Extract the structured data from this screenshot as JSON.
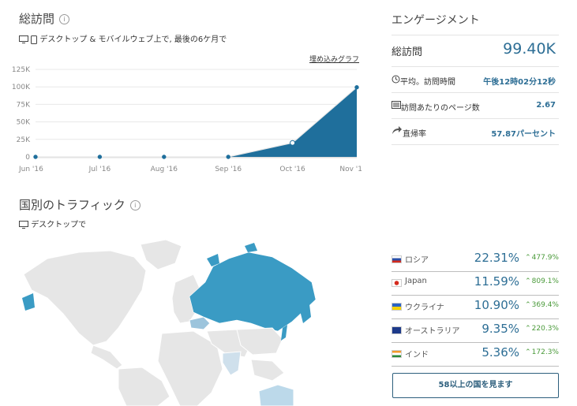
{
  "visits": {
    "title": "総訪問",
    "info_icon": "i",
    "subtitle": "デスクトップ & モバイルウェブ上で, 最後の6ケ月で",
    "embed_link": "埋め込みグラフ"
  },
  "chart_data": {
    "type": "area",
    "categories": [
      "Jun '16",
      "Jul '16",
      "Aug '16",
      "Sep '16",
      "Oct '16",
      "Nov '1"
    ],
    "series": [
      {
        "values": [
          0,
          0,
          0,
          0,
          20000,
          99400
        ]
      }
    ],
    "yticks": [
      "125K",
      "100K",
      "75K",
      "50K",
      "25K",
      "0"
    ],
    "ylim": [
      0,
      125000
    ],
    "grid": true,
    "color": "#1f6f9c"
  },
  "engagement": {
    "title": "エンゲージメント",
    "total_label": "総訪問",
    "total_value": "99.40K",
    "rows": [
      {
        "icon": "clock-icon",
        "label": "平均。訪問時間",
        "value": "午後12時02分12秒"
      },
      {
        "icon": "pages-icon",
        "label": "訪問あたりのページ数",
        "value": "2.67"
      },
      {
        "icon": "bounce-icon",
        "label": "直帰率",
        "value": "57.87パーセント"
      }
    ]
  },
  "traffic": {
    "title": "国別のトラフィック",
    "info_icon": "i",
    "subtitle": "デスクトップで",
    "countries": [
      {
        "name": "ロシア",
        "pct": "22.31%",
        "growth": "477.9%",
        "flag": "russia"
      },
      {
        "name": "Japan",
        "pct": "11.59%",
        "growth": "809.1%",
        "flag": "japan"
      },
      {
        "name": "ウクライナ",
        "pct": "10.90%",
        "growth": "369.4%",
        "flag": "ukraine"
      },
      {
        "name": "オーストラリア",
        "pct": "9.35%",
        "growth": "220.3%",
        "flag": "australia"
      },
      {
        "name": "インド",
        "pct": "5.36%",
        "growth": "172.3%",
        "flag": "india"
      }
    ],
    "more_button": "58以上の国を見ます"
  }
}
